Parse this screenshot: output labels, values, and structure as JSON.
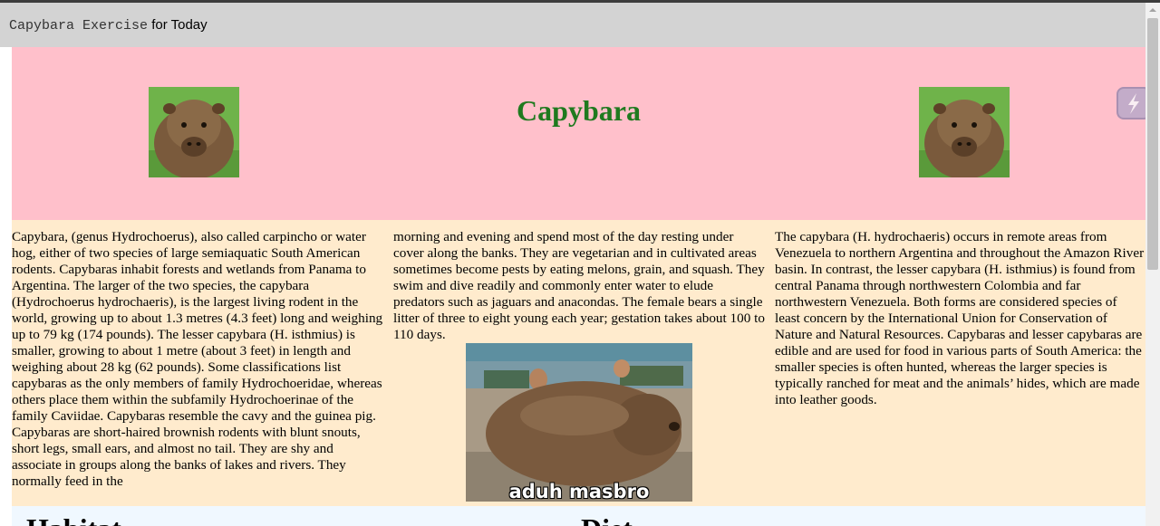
{
  "topbar": {
    "title_mono": "Capybara Exercise",
    "title_rest": " for Today"
  },
  "header": {
    "title": "Capybara"
  },
  "content": {
    "col1": "Capybara, (genus Hydrochoerus), also called carpincho or water hog, either of two species of large semiaquatic South American rodents. Capybaras inhabit forests and wetlands from Panama to Argentina. The larger of the two species, the capybara (Hydrochoerus hydrochaeris), is the largest living rodent in the world, growing up to about 1.3 metres (4.3 feet) long and weighing up to 79 kg (174 pounds). The lesser capybara (H. isthmius) is smaller, growing to about 1 metre (about 3 feet) in length and weighing about 28 kg (62 pounds). Some classifications list capybaras as the only members of family Hydrochoeridae, whereas others place them within the subfamily Hydrochoerinae of the family Caviidae. Capybaras resemble the cavy and the guinea pig. Capybaras are short-haired brownish rodents with blunt snouts, short legs, small ears, and almost no tail. They are shy and associate in groups along the banks of lakes and rivers. They normally feed in the",
    "col2": "morning and evening and spend most of the day resting under cover along the banks. They are vegetarian and in cultivated areas sometimes become pests by eating melons, grain, and squash. They swim and dive readily and commonly enter water to elude predators such as jaguars and anacondas. The female bears a single litter of three to eight young each year; gestation takes about 100 to 110 days.",
    "col3": "The capybara (H. hydrochaeris) occurs in remote areas from Venezuela to northern Argentina and throughout the Amazon River basin. In contrast, the lesser capybara (H. isthmius) is found from central Panama through northwestern Colombia and far northwestern Venezuela. Both forms are considered species of least concern by the International Union for Conservation of Nature and Natural Resources. Capybaras and lesser capybaras are edible and are used for food in various parts of South America: the smaller species is often hunted, whereas the larger species is typically ranched for meat and the animals’ hides, which are made into leather goods.",
    "meme_caption": "aduh masbro"
  },
  "bottom": {
    "habitat": "Habitat",
    "diet": "Diet"
  },
  "colors": {
    "topbar": "#d3d3d3",
    "header_bg": "#ffc0cb",
    "title_green": "#1f7a1f",
    "content_bg": "#ffebcd",
    "bottom_bg": "#f0f8ff"
  },
  "icons": {
    "side_tool": "lightning-icon",
    "scroll_up": "chevron-up-icon"
  }
}
